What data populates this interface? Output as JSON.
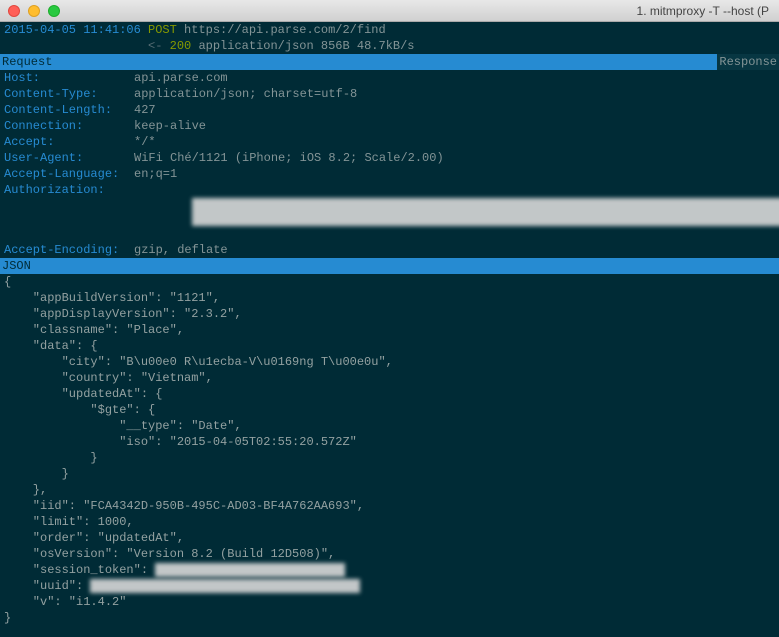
{
  "window": {
    "title": "1. mitmproxy -T --host (P"
  },
  "summary": {
    "timestamp": "2015-04-05 11:41:06",
    "method": "POST",
    "url": "https://api.parse.com/2/find",
    "arrow": "<-",
    "status": "200",
    "content_type": "application/json",
    "size": "856B",
    "rate": "48.7kB/s"
  },
  "tabs": {
    "request": "Request",
    "response": "Response"
  },
  "headers": {
    "host_k": "Host:",
    "host_v": "api.parse.com",
    "ctype_k": "Content-Type:",
    "ctype_v": "application/json; charset=utf-8",
    "clen_k": "Content-Length:",
    "clen_v": "427",
    "conn_k": "Connection:",
    "conn_v": "keep-alive",
    "accept_k": "Accept:",
    "accept_v": "*/*",
    "ua_k": "User-Agent:",
    "ua_v": "WiFi Ché/1121 (iPhone; iOS 8.2; Scale/2.00)",
    "alang_k": "Accept-Language:",
    "alang_v": "en;q=1",
    "auth_k": "Authorization:",
    "aenc_k": "Accept-Encoding:",
    "aenc_v": "gzip, deflate"
  },
  "json_label": "JSON",
  "json_body": "{\n    \"appBuildVersion\": \"1121\",\n    \"appDisplayVersion\": \"2.3.2\",\n    \"classname\": \"Place\",\n    \"data\": {\n        \"city\": \"B\\u00e0 R\\u1ecba-V\\u0169ng T\\u00e0u\",\n        \"country\": \"Vietnam\",\n        \"updatedAt\": {\n            \"$gte\": {\n                \"__type\": \"Date\",\n                \"iso\": \"2015-04-05T02:55:20.572Z\"\n            }\n        }\n    },\n    \"iid\": \"FCA4342D-950B-495C-AD03-BF4A762AA693\",\n    \"limit\": 1000,\n    \"order\": \"updatedAt\",\n    \"osVersion\": \"Version 8.2 (Build 12D508)\",",
  "json_tail": "    \"v\": \"i1.4.2\"\n}",
  "redacted": {
    "session_label": "    \"session_token\": ",
    "uuid_label": "    \"uuid\": "
  }
}
